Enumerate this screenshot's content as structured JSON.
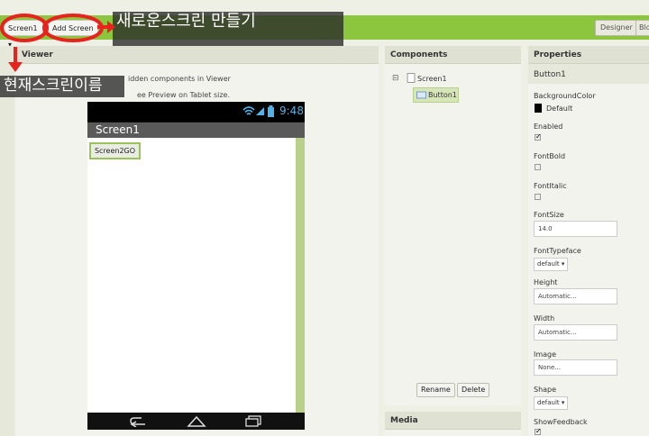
{
  "toolbar": {
    "screen_select_label": "Screen1 ▾",
    "add_screen_label": "Add Screen ...",
    "designer_label": "Designer",
    "blocks_label": "Blo"
  },
  "annotations": {
    "new_screen_note": "새로운스크린 만들기",
    "current_screen_note": "현재스크린이름"
  },
  "viewer": {
    "title": "Viewer",
    "hidden_components_text": "idden components in Viewer",
    "tablet_preview_text": "ee Preview on Tablet size.",
    "status_time": "9:48",
    "screen_title": "Screen1",
    "button_text": "Screen2GO"
  },
  "components": {
    "title": "Components",
    "tree": {
      "root_label": "Screen1",
      "child_label": "Button1"
    },
    "rename_label": "Rename",
    "delete_label": "Delete"
  },
  "media": {
    "title": "Media"
  },
  "properties": {
    "title": "Properties",
    "component_name": "Button1",
    "background_color_label": "BackgroundColor",
    "background_color_value": "Default",
    "enabled_label": "Enabled",
    "fontbold_label": "FontBold",
    "fontitalic_label": "FontItalic",
    "fontsize_label": "FontSize",
    "fontsize_value": "14.0",
    "fonttypeface_label": "FontTypeface",
    "fonttypeface_value": "default ▾",
    "height_label": "Height",
    "height_value": "Automatic...",
    "width_label": "Width",
    "width_value": "Automatic...",
    "image_label": "Image",
    "image_value": "None...",
    "shape_label": "Shape",
    "shape_value": "default ▾",
    "showfeedback_label": "ShowFeedback"
  },
  "colors": {
    "accent": "#8cc63f",
    "annotation_red": "#e8231d"
  }
}
